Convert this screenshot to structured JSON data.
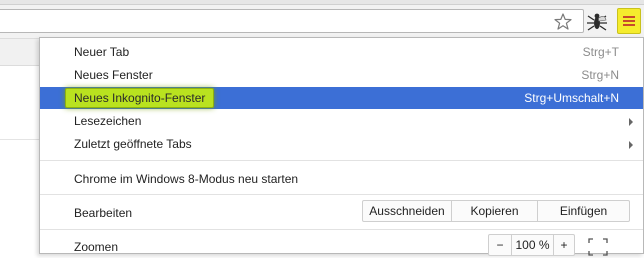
{
  "menu": {
    "items": [
      {
        "label": "Neuer Tab",
        "shortcut": "Strg+T"
      },
      {
        "label": "Neues Fenster",
        "shortcut": "Strg+N"
      },
      {
        "label": "Neues Inkognito-Fenster",
        "shortcut": "Strg+Umschalt+N"
      },
      {
        "label": "Lesezeichen"
      },
      {
        "label": "Zuletzt geöffnete Tabs"
      },
      {
        "label": "Chrome im Windows 8-Modus neu starten"
      }
    ],
    "edit": {
      "label": "Bearbeiten",
      "cut": "Ausschneiden",
      "copy": "Kopieren",
      "paste": "Einfügen"
    },
    "zoom": {
      "label": "Zoomen",
      "minus": "−",
      "level": "100 %",
      "plus": "+"
    }
  },
  "colors": {
    "highlight_row": "#3c6fd6",
    "highlight_label": "#b9e21f",
    "menu_button": "#f5ec2d",
    "menu_button_bars": "#c64a2b"
  },
  "icons": {
    "bookmark": "star-icon",
    "extension": "extension-icon",
    "menu": "hamburger-menu-icon",
    "submenu": "chevron-right-icon",
    "fullscreen": "fullscreen-icon"
  }
}
